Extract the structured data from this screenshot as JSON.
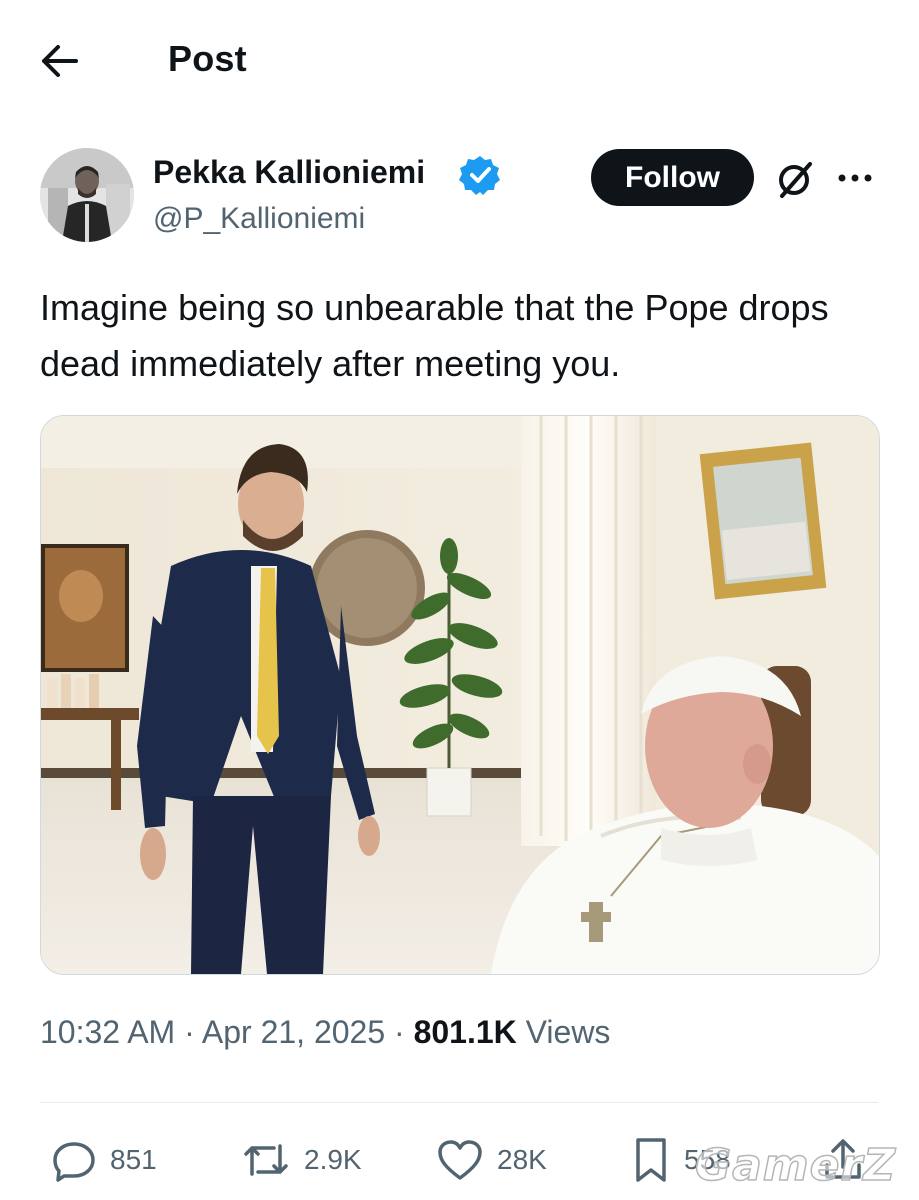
{
  "header": {
    "title": "Post"
  },
  "author": {
    "display_name": "Pekka Kallioniemi",
    "handle": "@P_Kallioniemi",
    "follow_label": "Follow"
  },
  "tweet": {
    "text": "Imagine being so unbearable that the Pope drops dead immediately after meeting you.",
    "time": "10:32 AM",
    "date": "Apr 21, 2025",
    "views_count": "801.1K",
    "views_label": "Views"
  },
  "actions": {
    "replies": "851",
    "reposts": "2.9K",
    "likes": "28K",
    "bookmarks": "558"
  },
  "watermark": "GamerZ",
  "colors": {
    "primary_text": "#0f1419",
    "secondary_text": "#536471",
    "verified": "#1d9bf0",
    "follow_bg": "#0f1419"
  },
  "icons": [
    "back-arrow-icon",
    "verified-badge-icon",
    "grok-icon",
    "more-icon",
    "reply-icon",
    "repost-icon",
    "like-icon",
    "bookmark-icon",
    "share-icon"
  ]
}
